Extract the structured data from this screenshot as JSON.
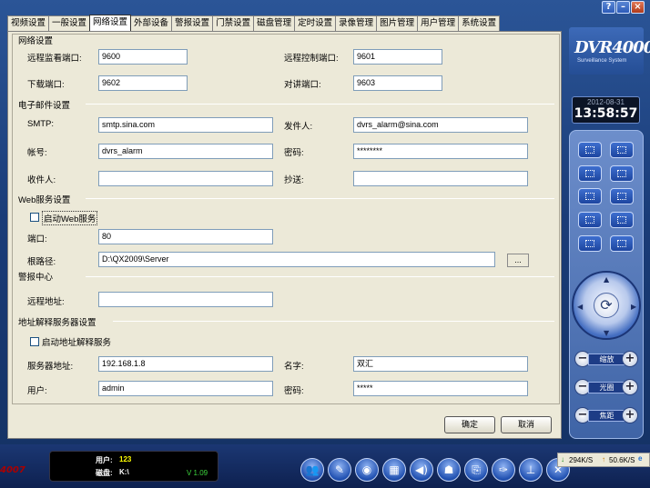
{
  "window": {
    "help": "?",
    "minimize": "–",
    "close": "×"
  },
  "tabs": [
    "视频设置",
    "一般设置",
    "网络设置",
    "外部设备",
    "警报设置",
    "门禁设置",
    "磁盘管理",
    "定时设置",
    "录像管理",
    "图片管理",
    "用户管理",
    "系统设置"
  ],
  "active_tab": "网络设置",
  "network": {
    "title": "网络设置",
    "remote_monitor_port_label": "远程监看端口:",
    "remote_monitor_port": "9600",
    "remote_control_port_label": "远程控制端口:",
    "remote_control_port": "9601",
    "download_port_label": "下载端口:",
    "download_port": "9602",
    "talk_port_label": "对讲端口:",
    "talk_port": "9603"
  },
  "email": {
    "title": "电子邮件设置",
    "smtp_label": "SMTP:",
    "smtp": "smtp.sina.com",
    "sender_label": "发件人:",
    "sender": "dvrs_alarm@sina.com",
    "account_label": "帐号:",
    "account": "dvrs_alarm",
    "password_label": "密码:",
    "password": "********",
    "recipient_label": "收件人:",
    "recipient": "",
    "cc_label": "抄送:",
    "cc": ""
  },
  "web": {
    "title": "Web服务设置",
    "enable_label": "启动Web服务",
    "port_label": "端口:",
    "port": "80",
    "root_label": "根路径:",
    "root": "D:\\QX2009\\Server",
    "browse": "..."
  },
  "alarm_center": {
    "title": "警报中心",
    "remote_addr_label": "远程地址:",
    "remote_addr": ""
  },
  "ddns": {
    "title": "地址解释服务器设置",
    "enable_label": "启动地址解释服务",
    "server_label": "服务器地址:",
    "server": "192.168.1.8",
    "name_label": "名字:",
    "name": "双汇",
    "user_label": "用户:",
    "user": "admin",
    "password_label": "密码:",
    "password": "*****"
  },
  "buttons": {
    "ok": "确定",
    "cancel": "取消"
  },
  "logo": {
    "title": "DVR4000",
    "subtitle": "Surveillance System"
  },
  "clock": {
    "date": "2012-08-31",
    "time": "13:58:57"
  },
  "ptz": {
    "zoom": "缩放",
    "focus": "光圈",
    "iris": "焦距"
  },
  "status": {
    "user_label": "用户:",
    "user": "123",
    "disk_label": "磁盘:",
    "disk": "K:\\",
    "version": "V 1.09"
  },
  "brand_left": "4007",
  "network_speed": {
    "down": "294K/S",
    "up": "50.6K/S"
  },
  "colors": {
    "accent": "#1e3f7a",
    "clock_time": "#ffffff",
    "user_value": "#ffff00"
  }
}
